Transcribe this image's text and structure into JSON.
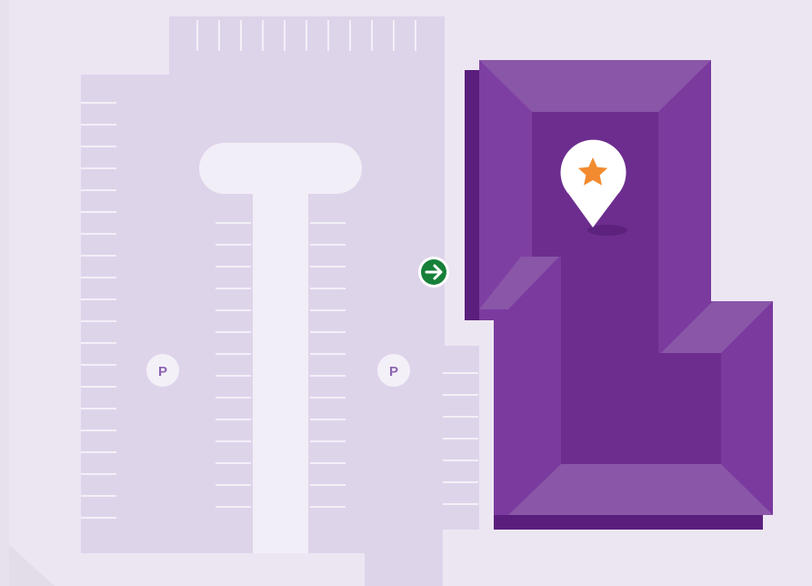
{
  "map": {
    "colors": {
      "background": "#ece6f2",
      "parking_lot": "#ded4ea",
      "parking_lines": "#ffffff",
      "building_roof": "#6c2d8f",
      "building_wall": "#7a3a9e",
      "building_edge": "#8a56a8",
      "building_shadow": "#5a1f7d",
      "parking_badge_text": "#8a63b0",
      "entrance_green": "#188038",
      "destination_star": "#f28b30"
    },
    "parking_labels": [
      {
        "id": "west",
        "text": "P"
      },
      {
        "id": "east",
        "text": "P"
      }
    ],
    "entrance": {
      "icon": "arrow-right-icon"
    },
    "destination": {
      "icon": "star-pin-icon"
    }
  }
}
